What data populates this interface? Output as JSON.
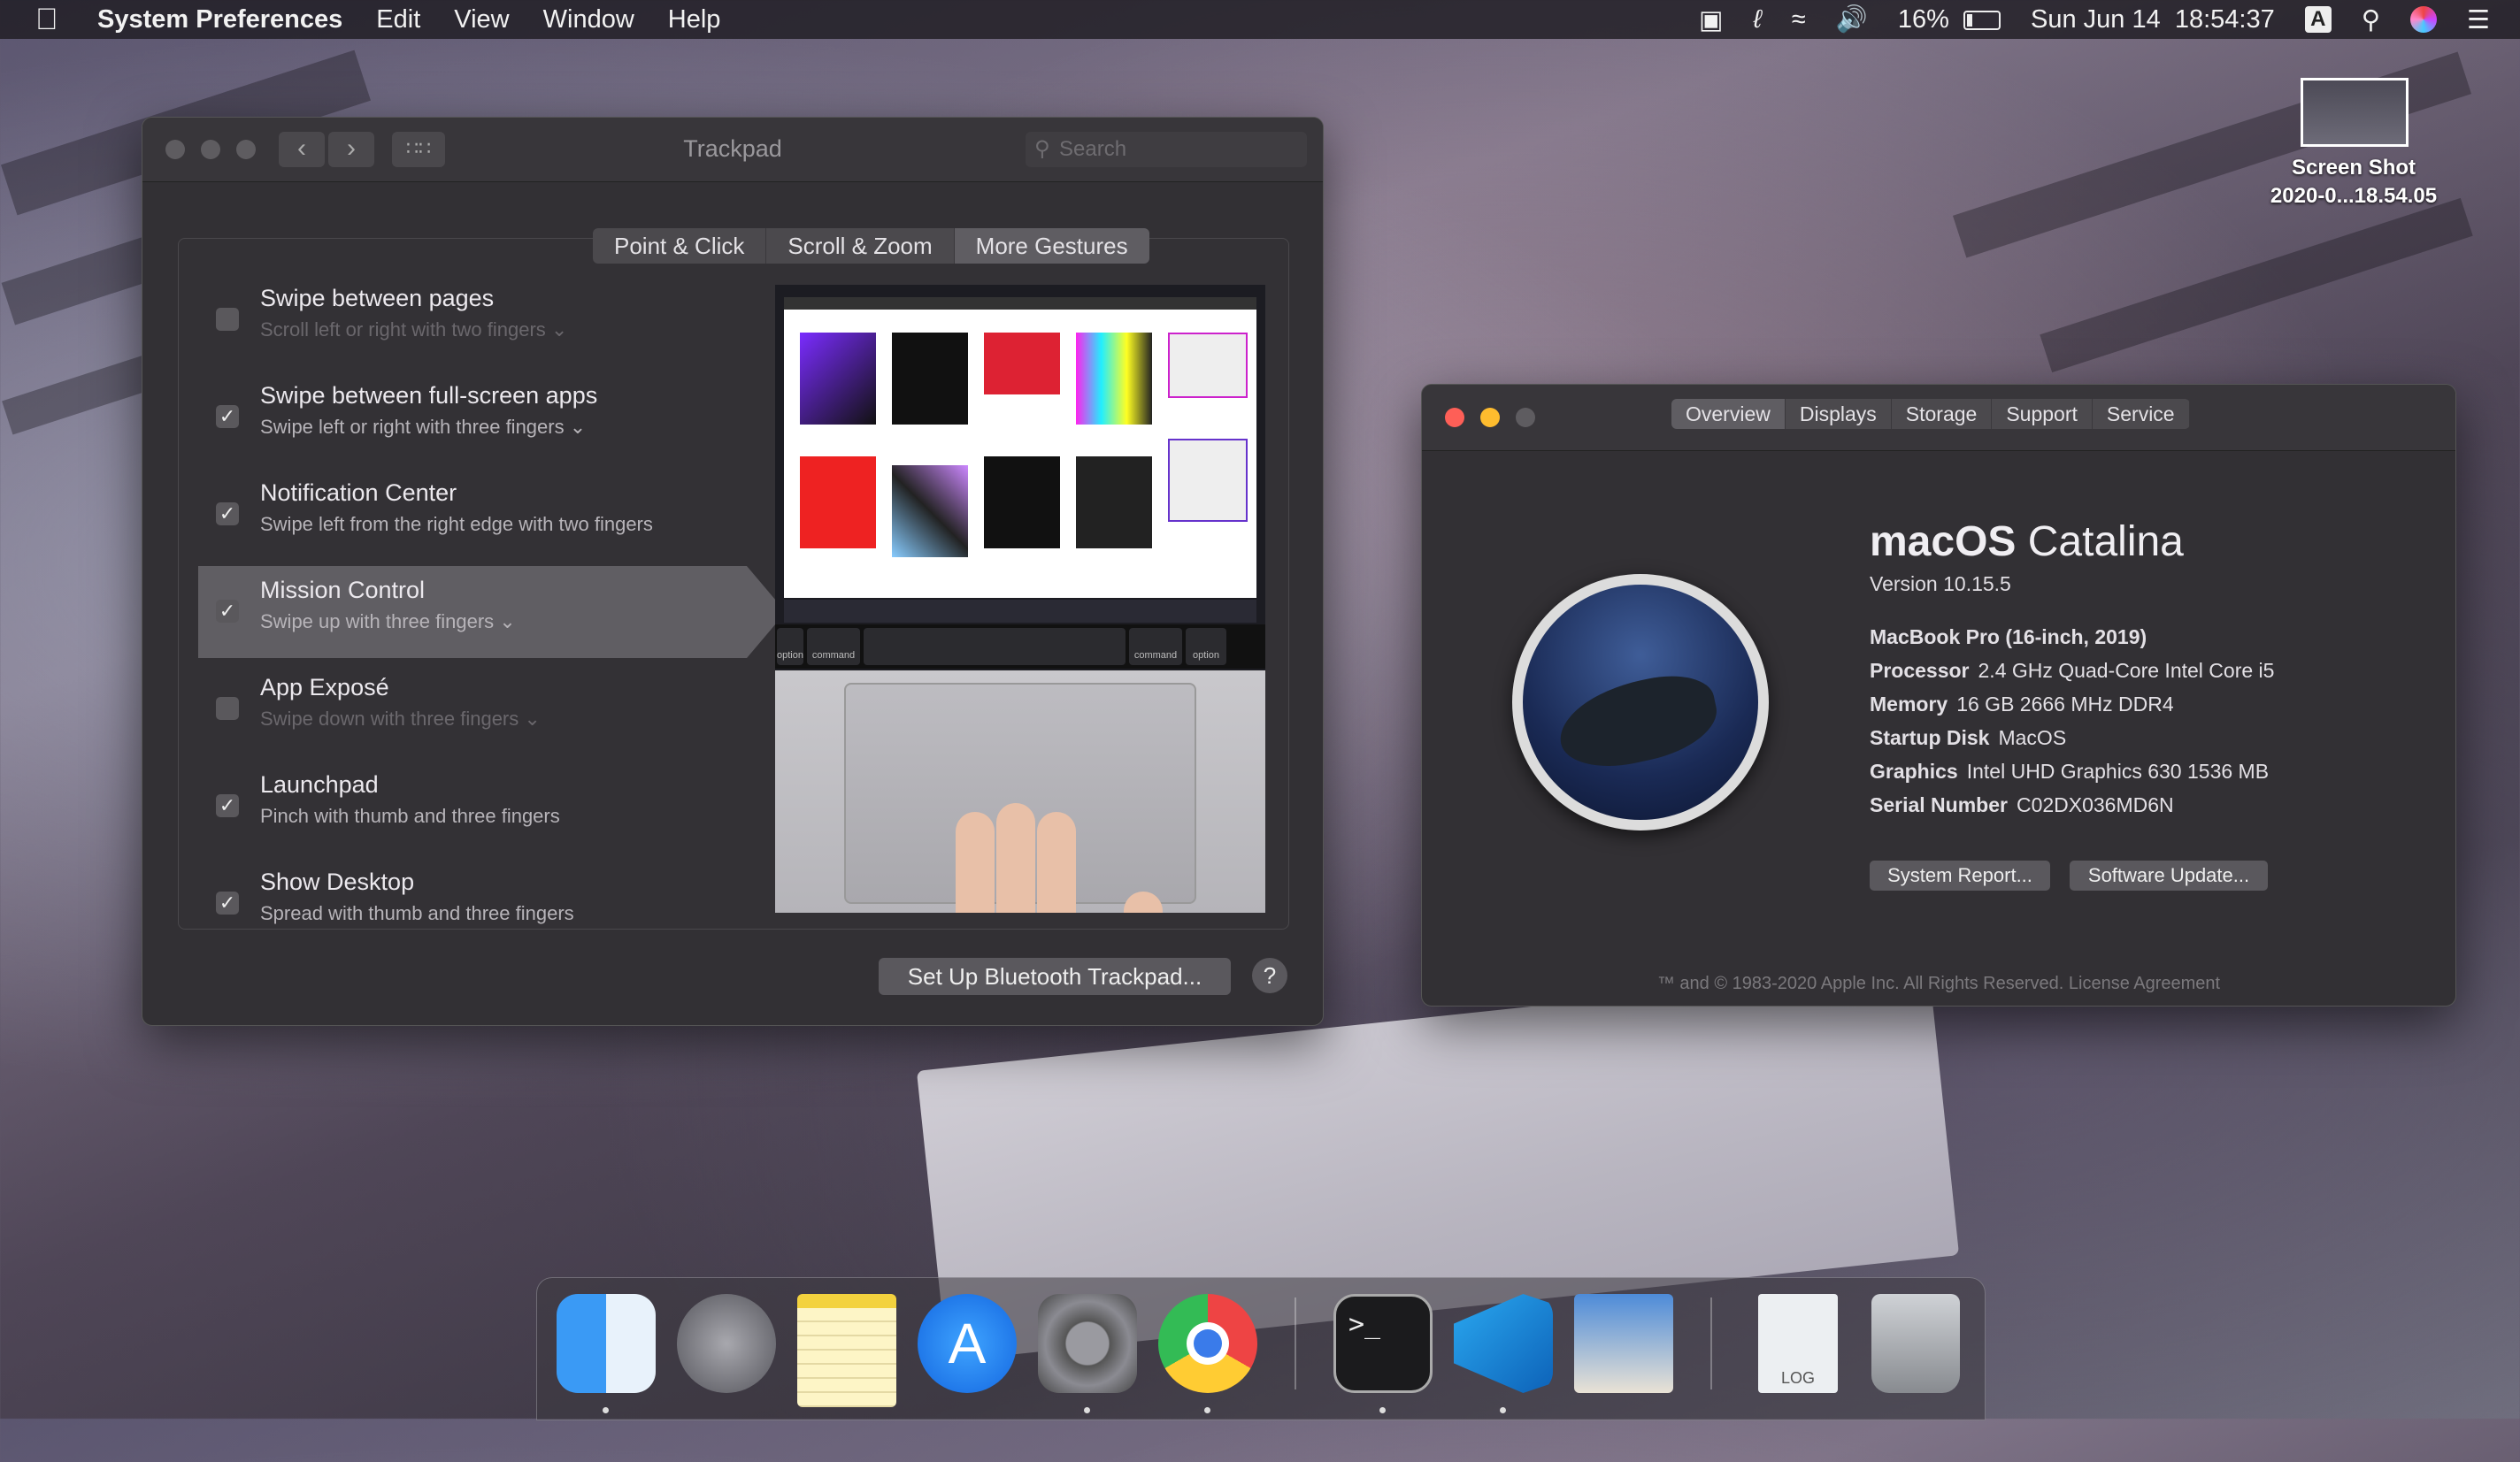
{
  "menubar": {
    "app_name": "System Preferences",
    "menus": [
      "Edit",
      "View",
      "Window",
      "Help"
    ],
    "battery_percent": "16%",
    "battery_level": 0.16,
    "date": "Sun Jun 14",
    "time": "18:54:37",
    "input_source": "A"
  },
  "desktop": {
    "file_name_line1": "Screen Shot",
    "file_name_line2": "2020-0...18.54.05"
  },
  "trackpad": {
    "title": "Trackpad",
    "search_placeholder": "Search",
    "tabs": [
      "Point & Click",
      "Scroll & Zoom",
      "More Gestures"
    ],
    "active_tab": "More Gestures",
    "gestures": [
      {
        "title": "Swipe between pages",
        "subtitle": "Scroll left or right with two fingers",
        "checked": false,
        "has_menu": true
      },
      {
        "title": "Swipe between full-screen apps",
        "subtitle": "Swipe left or right with three fingers",
        "checked": true,
        "has_menu": true
      },
      {
        "title": "Notification Center",
        "subtitle": "Swipe left from the right edge with two fingers",
        "checked": true,
        "has_menu": false
      },
      {
        "title": "Mission Control",
        "subtitle": "Swipe up with three fingers",
        "checked": true,
        "has_menu": true
      },
      {
        "title": "App Exposé",
        "subtitle": "Swipe down with three fingers",
        "checked": false,
        "has_menu": true
      },
      {
        "title": "Launchpad",
        "subtitle": "Pinch with thumb and three fingers",
        "checked": true,
        "has_menu": false
      },
      {
        "title": "Show Desktop",
        "subtitle": "Spread with thumb and three fingers",
        "checked": true,
        "has_menu": false
      }
    ],
    "selected_gesture": "Mission Control",
    "setup_button": "Set Up Bluetooth Trackpad...",
    "help_button": "?",
    "preview_keys": [
      "option",
      "command",
      "command",
      "option"
    ]
  },
  "about": {
    "tabs": [
      "Overview",
      "Displays",
      "Storage",
      "Support",
      "Service"
    ],
    "active_tab": "Overview",
    "os_name_bold": "macOS",
    "os_name_light": "Catalina",
    "version": "Version 10.15.5",
    "model": "MacBook Pro (16-inch, 2019)",
    "specs": [
      {
        "key": "Processor",
        "value": "2.4 GHz Quad-Core Intel Core i5"
      },
      {
        "key": "Memory",
        "value": "16 GB 2666 MHz DDR4"
      },
      {
        "key": "Startup Disk",
        "value": "MacOS"
      },
      {
        "key": "Graphics",
        "value": "Intel UHD Graphics 630 1536 MB"
      },
      {
        "key": "Serial Number",
        "value": "C02DX036MD6N"
      }
    ],
    "system_report_button": "System Report...",
    "software_update_button": "Software Update...",
    "footer": "™ and © 1983-2020 Apple Inc. All Rights Reserved. License Agreement"
  },
  "dock": {
    "apps": [
      "finder",
      "launchpad",
      "notes",
      "app-store",
      "system-preferences",
      "chrome",
      "terminal",
      "vscode",
      "preview",
      "console-log",
      "trash"
    ],
    "running": [
      "finder",
      "system-preferences",
      "chrome",
      "terminal",
      "vscode"
    ],
    "log_label": "LOG",
    "terminal_prompt": ">_"
  },
  "colors": {
    "close": "#fe5f57",
    "minimize": "#febc2e",
    "zoom_inactive": "#5e5c60",
    "accent": "#5f5d62"
  }
}
